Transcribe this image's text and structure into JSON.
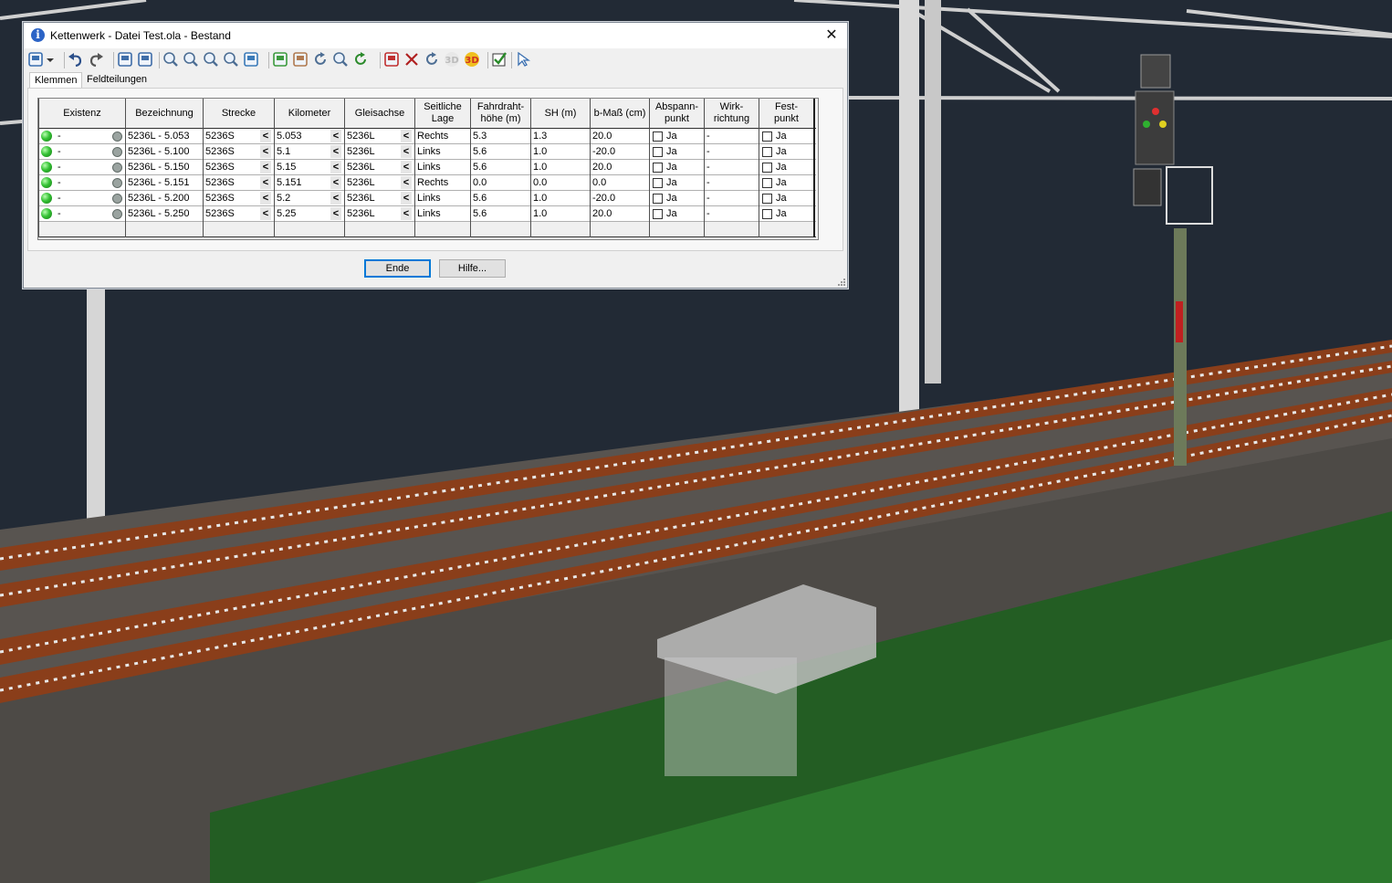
{
  "window": {
    "title": "Kettenwerk - Datei Test.ola - Bestand",
    "close_glyph": "✕"
  },
  "toolbar": {
    "icons": [
      "save-icon",
      "dropdown-arrow-icon",
      "undo-icon",
      "redo-icon",
      "copy-icon",
      "export-icon",
      "zoom-window-icon",
      "zoom-in-icon",
      "zoom-out-icon",
      "zoom-all-icon",
      "view-3d-box-icon",
      "pen-icon",
      "hand-icon",
      "rotate-icon",
      "zoom-search-icon",
      "refresh-icon",
      "draw-icon",
      "cut-icon",
      "redraw-icon",
      "3d-gray-icon",
      "3d-icon",
      "check-icon",
      "pointer-icon"
    ]
  },
  "tabs": [
    {
      "label": "Klemmen",
      "active": true
    },
    {
      "label": "Feldteilungen",
      "active": false
    }
  ],
  "table": {
    "columns": [
      "Existenz",
      "Bezeichnung",
      "Strecke",
      "Kilometer",
      "Gleisachse",
      "Seitliche Lage",
      "Fahrdraht-\nhöhe (m)",
      "SH (m)",
      "b-Maß (cm)",
      "Abspann-\npunkt",
      "Wirk-\nrichtung",
      "Fest-\npunkt"
    ],
    "rows": [
      {
        "existenz": "-",
        "bezeichnung": "5236L - 5.053",
        "strecke": "5236S",
        "kilometer": "5.053",
        "gleisachse": "5236L",
        "lage": "Rechts",
        "fahrdraht": "5.3",
        "sh": "1.3",
        "bmass": "20.0",
        "abspann": "Ja",
        "wirk": "-",
        "fest": "Ja"
      },
      {
        "existenz": "-",
        "bezeichnung": "5236L - 5.100",
        "strecke": "5236S",
        "kilometer": "5.1",
        "gleisachse": "5236L",
        "lage": "Links",
        "fahrdraht": "5.6",
        "sh": "1.0",
        "bmass": "-20.0",
        "abspann": "Ja",
        "wirk": "-",
        "fest": "Ja"
      },
      {
        "existenz": "-",
        "bezeichnung": "5236L - 5.150",
        "strecke": "5236S",
        "kilometer": "5.15",
        "gleisachse": "5236L",
        "lage": "Links",
        "fahrdraht": "5.6",
        "sh": "1.0",
        "bmass": "20.0",
        "abspann": "Ja",
        "wirk": "-",
        "fest": "Ja"
      },
      {
        "existenz": "-",
        "bezeichnung": "5236L - 5.151",
        "strecke": "5236S",
        "kilometer": "5.151",
        "gleisachse": "5236L",
        "lage": "Rechts",
        "fahrdraht": "0.0",
        "sh": "0.0",
        "bmass": "0.0",
        "abspann": "Ja",
        "wirk": "-",
        "fest": "Ja"
      },
      {
        "existenz": "-",
        "bezeichnung": "5236L - 5.200",
        "strecke": "5236S",
        "kilometer": "5.2",
        "gleisachse": "5236L",
        "lage": "Links",
        "fahrdraht": "5.6",
        "sh": "1.0",
        "bmass": "-20.0",
        "abspann": "Ja",
        "wirk": "-",
        "fest": "Ja"
      },
      {
        "existenz": "-",
        "bezeichnung": "5236L - 5.250",
        "strecke": "5236S",
        "kilometer": "5.25",
        "gleisachse": "5236L",
        "lage": "Links",
        "fahrdraht": "5.6",
        "sh": "1.0",
        "bmass": "20.0",
        "abspann": "Ja",
        "wirk": "-",
        "fest": "Ja"
      }
    ],
    "chevron_glyph": "<"
  },
  "buttons": {
    "ende": "Ende",
    "hilfe": "Hilfe..."
  },
  "toolbar_3d_label": "3D",
  "colors": {
    "background": "#222a35",
    "ground_green": "#1f5a1f",
    "rail_brown": "#8a3e1a",
    "accent_blue": "#0078d7"
  }
}
